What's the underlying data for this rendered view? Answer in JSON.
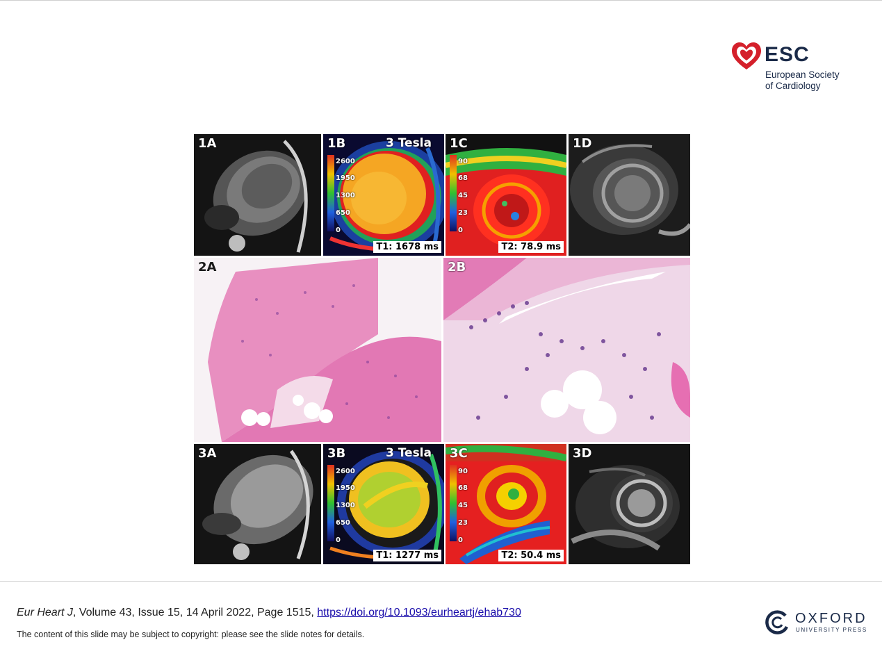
{
  "header": {
    "esc_logo": {
      "name": "ESC",
      "line1": "European Society",
      "line2": "of Cardiology",
      "color": "#d4202b"
    }
  },
  "figure": {
    "row1": {
      "p1a": {
        "label": "1A"
      },
      "p1b": {
        "label": "1B",
        "field": "3 Tesla",
        "measurement": "T1: 1678 ms",
        "scale_ticks": [
          "2600",
          "1950",
          "1300",
          "650",
          "0"
        ]
      },
      "p1c": {
        "label": "1C",
        "measurement": "T2: 78.9 ms",
        "scale_ticks": [
          "90",
          "68",
          "45",
          "23",
          "0"
        ]
      },
      "p1d": {
        "label": "1D"
      }
    },
    "row2": {
      "p2a": {
        "label": "2A"
      },
      "p2b": {
        "label": "2B"
      }
    },
    "row3": {
      "p3a": {
        "label": "3A"
      },
      "p3b": {
        "label": "3B",
        "field": "3 Tesla",
        "measurement": "T1: 1277 ms",
        "scale_ticks": [
          "2600",
          "1950",
          "1300",
          "650",
          "0"
        ]
      },
      "p3c": {
        "label": "3C",
        "measurement": "T2: 50.4 ms",
        "scale_ticks": [
          "90",
          "68",
          "45",
          "23",
          "0"
        ]
      },
      "p3d": {
        "label": "3D"
      }
    }
  },
  "footer": {
    "journal": "Eur Heart J",
    "details": ", Volume 43, Issue 15, 14 April 2022, Page 1515, ",
    "doi": "https://doi.org/10.1093/eurheartj/ehab730",
    "notes": "The content of this slide may be subject to copyright: please see the slide notes for details.",
    "oup_logo": {
      "name": "OXFORD",
      "sub": "UNIVERSITY PRESS"
    }
  }
}
